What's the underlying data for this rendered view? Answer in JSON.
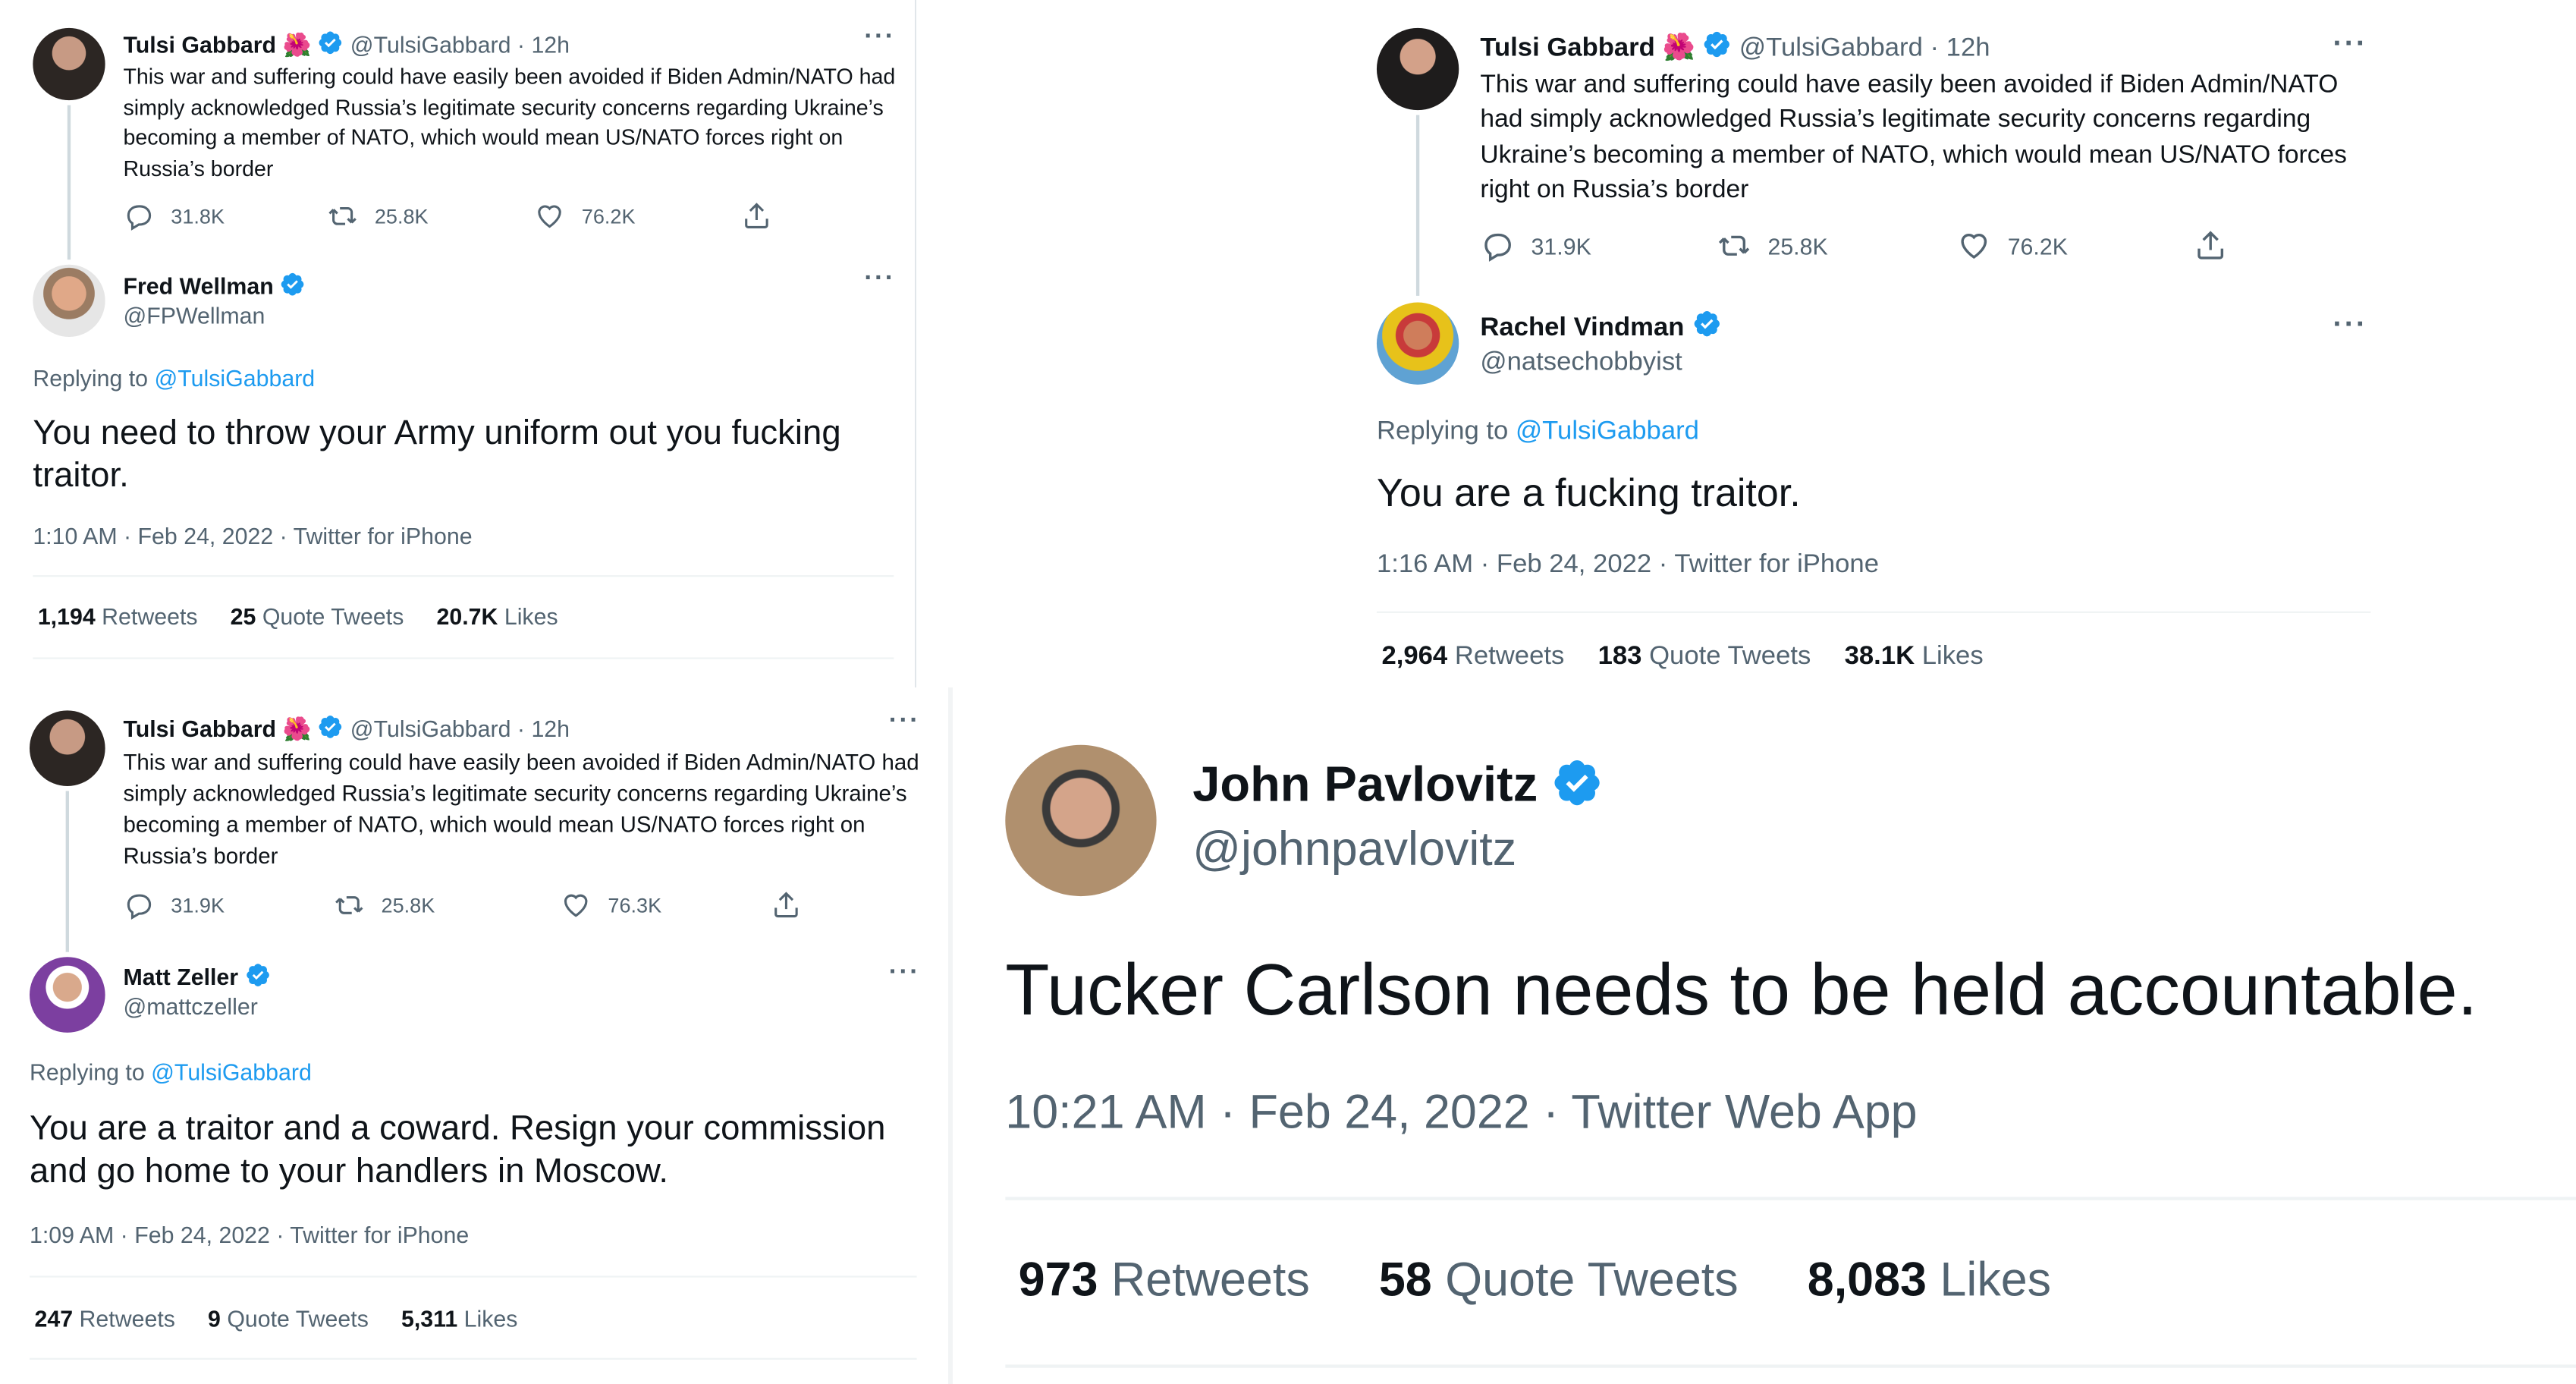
{
  "parent_tweet": {
    "name": "Tulsi Gabbard",
    "emoji": "🌺",
    "handle": "@TulsiGabbard",
    "time": "· 12h",
    "text": "This war and suffering could have easily been avoided if Biden Admin/NATO had simply acknowledged Russia’s legitimate security concerns regarding Ukraine’s becoming a member of NATO, which would mean US/NATO forces right on Russia’s border"
  },
  "panels": [
    {
      "parent_counts": {
        "replies": "31.8K",
        "retweets": "25.8K",
        "likes": "76.2K"
      },
      "reply": {
        "name": "Fred Wellman",
        "handle": "@FPWellman",
        "replying_label": "Replying to",
        "replying_to": "@TulsiGabbard",
        "text": "You need to throw your Army uniform out you fucking traitor.",
        "meta": "1:10 AM · Feb 24, 2022 · Twitter for iPhone",
        "retweets": "1,194",
        "retweets_label": "Retweets",
        "quotes": "25",
        "quotes_label": "Quote Tweets",
        "likes": "20.7K",
        "likes_label": "Likes"
      }
    },
    {
      "parent_counts": {
        "replies": "31.9K",
        "retweets": "25.8K",
        "likes": "76.2K"
      },
      "reply": {
        "name": "Rachel Vindman",
        "handle": "@natsechobbyist",
        "replying_label": "Replying to",
        "replying_to": "@TulsiGabbard",
        "text": "You are a fucking traitor.",
        "meta": "1:16 AM · Feb 24, 2022 · Twitter for iPhone",
        "retweets": "2,964",
        "retweets_label": "Retweets",
        "quotes": "183",
        "quotes_label": "Quote Tweets",
        "likes": "38.1K",
        "likes_label": "Likes"
      }
    },
    {
      "parent_counts": {
        "replies": "31.9K",
        "retweets": "25.8K",
        "likes": "76.3K"
      },
      "reply": {
        "name": "Matt Zeller",
        "handle": "@mattczeller",
        "replying_label": "Replying to",
        "replying_to": "@TulsiGabbard",
        "text": "You are a traitor and a coward. Resign your commission and go home to your handlers in Moscow.",
        "meta": "1:09 AM · Feb 24, 2022 · Twitter for iPhone",
        "retweets": "247",
        "retweets_label": "Retweets",
        "quotes": "9",
        "quotes_label": "Quote Tweets",
        "likes": "5,311",
        "likes_label": "Likes"
      }
    }
  ],
  "standalone": {
    "name": "John Pavlovitz",
    "handle": "@johnpavlovitz",
    "text": "Tucker Carlson needs to be held accountable.",
    "meta": "10:21 AM · Feb 24, 2022 · Twitter Web App",
    "retweets": "973",
    "retweets_label": "Retweets",
    "quotes": "58",
    "quotes_label": "Quote Tweets",
    "likes": "8,083",
    "likes_label": "Likes"
  },
  "colors": {
    "accent": "#1d9bf0",
    "muted": "#536471",
    "text": "#0f1419"
  },
  "icons": [
    "verified-badge-icon",
    "more-icon",
    "reply-icon",
    "retweet-icon",
    "like-icon",
    "share-icon"
  ]
}
